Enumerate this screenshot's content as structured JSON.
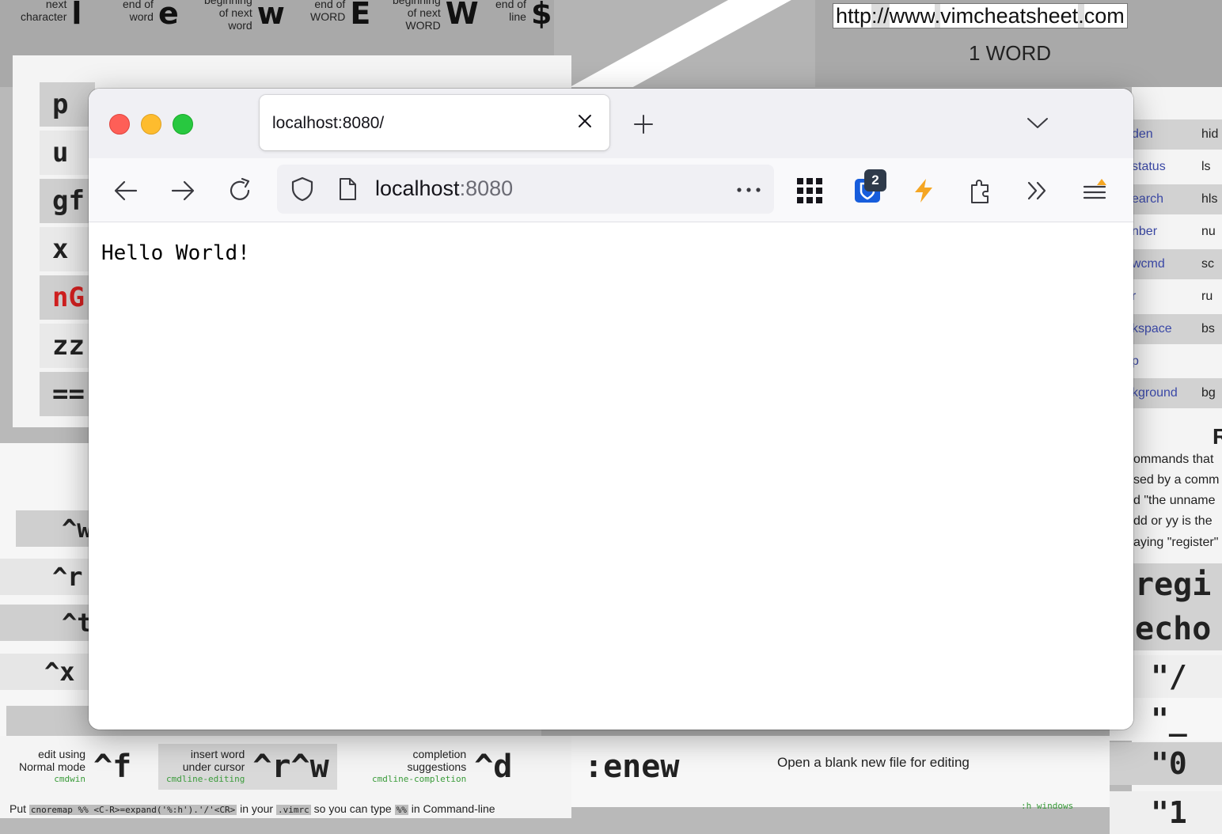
{
  "background": {
    "motions": [
      {
        "label": "next\ncharacter",
        "key": "l"
      },
      {
        "label": "end of\nword",
        "key": "e"
      },
      {
        "label": "beginning\nof next\nword",
        "key": "w"
      },
      {
        "label": "end of\nWORD",
        "key": "E"
      },
      {
        "label": "beginning\nof next\nWORD",
        "key": "W"
      },
      {
        "label": "end of\nline",
        "key": "$"
      }
    ],
    "url_parts": [
      "http",
      "://",
      "www",
      ".",
      "vimcheatsheet",
      ".",
      "com"
    ],
    "url_label": "1 WORD",
    "left_keys": [
      "p",
      "u",
      "gf",
      "x",
      "nG",
      "zz",
      "=="
    ],
    "left_lower_keys": [
      "^w",
      "^r",
      "^t",
      "^x"
    ],
    "bottom_cells": [
      {
        "text": "edit using\nNormal mode",
        "tag": "cmdwin",
        "key": "^f"
      },
      {
        "text": "insert word\nunder cursor",
        "tag": "cmdline-editing",
        "key": "^r^w"
      },
      {
        "text": "completion\nsuggestions",
        "tag": "cmdline-completion",
        "key": "^d"
      }
    ],
    "tip": {
      "pre": "Put",
      "c1": "cnoremap %% <C-R>=expand('%:h').'/'<CR>",
      "mid": "in your",
      "c2": ".vimrc",
      "mid2": "so you can type",
      "c3": "%%",
      "post": "in Command-line"
    },
    "enew_key": ":enew",
    "enew_desc": "Open a blank new file for editing",
    "h_windows": ":h windows",
    "right_options": [
      {
        "a": "den",
        "b": "hid"
      },
      {
        "a": "status",
        "b": "ls"
      },
      {
        "a": "earch",
        "b": "hls"
      },
      {
        "a": "nber",
        "b": "nu"
      },
      {
        "a": "wcmd",
        "b": "sc"
      },
      {
        "a": "r",
        "b": "ru"
      },
      {
        "a": "kspace",
        "b": "bs"
      },
      {
        "a": "p",
        "b": ""
      },
      {
        "a": "kground",
        "b": "bg"
      }
    ],
    "right_heading": "R",
    "right_lines": [
      "ommands that",
      "sed by a comm",
      "d \"the unname",
      "dd or yy is the",
      "aying \"register\""
    ],
    "right_big": [
      "regi",
      "echo"
    ],
    "right_keys": [
      "\"/",
      "\"_",
      "\"0",
      "\"1"
    ]
  },
  "browser": {
    "tab_title": "localhost:8080/",
    "url_host": "localhost",
    "url_port": ":8080",
    "extension_badge": "2",
    "page_text": "Hello World!"
  }
}
